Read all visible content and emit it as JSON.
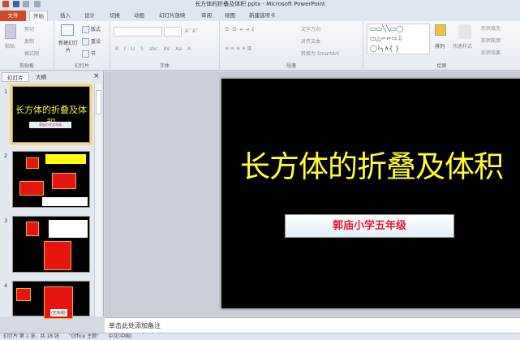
{
  "window": {
    "title": "长方体的折叠及体积.pptx - Microsoft PowerPoint"
  },
  "tabs": [
    "文件",
    "开始",
    "插入",
    "设计",
    "切换",
    "动画",
    "幻灯片放映",
    "审阅",
    "视图",
    "新建选项卡"
  ],
  "ribbon": {
    "clipboard": {
      "paste": "粘贴",
      "cut": "剪切",
      "copy": "复制",
      "format_painter": "格式刷",
      "label": "剪贴板"
    },
    "slides": {
      "new_slide": "新建幻灯片",
      "layout": "版式",
      "reset": "重设",
      "section": "节",
      "label": "幻灯片"
    },
    "font": {
      "label": "字体",
      "buttons": [
        "B",
        "I",
        "U",
        "S",
        "abc",
        "AV",
        "Aa",
        "A"
      ]
    },
    "paragraph": {
      "text_direction": "文字方向",
      "align_text": "对齐文本",
      "convert_smartart": "转换为 SmartArt",
      "label": "段落"
    },
    "drawing": {
      "arrange": "排列",
      "quick_styles": "快速样式",
      "shape_fill": "形状填充",
      "shape_outline": "形状轮廓",
      "shape_effects": "形状效果",
      "label": "绘图"
    }
  },
  "left_panel": {
    "tabs": [
      "幻灯片",
      "大纲"
    ],
    "close": "×",
    "slides": [
      {
        "num": "1"
      },
      {
        "num": "2"
      },
      {
        "num": "3"
      },
      {
        "num": "4",
        "label": "(无标题)"
      }
    ]
  },
  "slide": {
    "title": "长方体的折叠及体积",
    "subtitle": "郭庙小学五年级"
  },
  "notes": {
    "placeholder": "单击此处添加备注"
  },
  "status": {
    "slide_count": "幻灯片 第 1 张，共 18 张",
    "theme": "\"Office 主题\"",
    "language": "中文(中国)"
  }
}
